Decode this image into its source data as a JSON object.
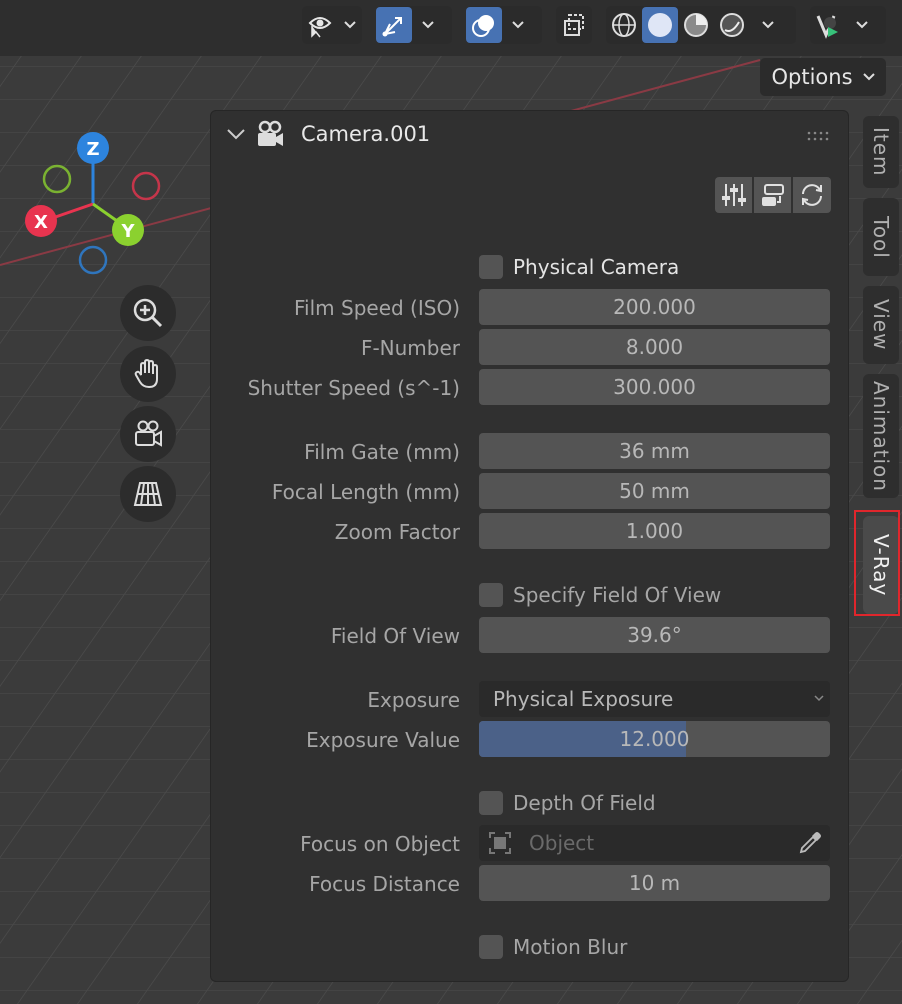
{
  "toolbar": {
    "buttons": [
      {
        "icon": "visibility-selectable-icon",
        "active": false
      },
      {
        "icon": "gizmo-toggle-icon",
        "active": true
      },
      {
        "icon": "overlay-toggle-icon",
        "active": true
      },
      {
        "icon": "xray-toggle-icon",
        "active": false
      },
      {
        "icon": "wireframe-shading-icon",
        "active": false
      },
      {
        "icon": "solid-shading-icon",
        "active": true
      },
      {
        "icon": "material-preview-shading-icon",
        "active": false
      },
      {
        "icon": "rendered-shading-icon",
        "active": false
      },
      {
        "icon": "vray-render-icon",
        "active": false
      }
    ],
    "options_label": "Options"
  },
  "gizmo": {
    "x": "X",
    "y": "Y",
    "z": "Z"
  },
  "nav_icons": [
    "zoom-icon",
    "pan-hand-icon",
    "camera-view-icon",
    "ortho-grid-icon"
  ],
  "panel": {
    "title": "Camera.001",
    "physical_camera": "Physical Camera",
    "film_speed": {
      "label": "Film Speed (ISO)",
      "value": "200.000"
    },
    "f_number": {
      "label": "F-Number",
      "value": "8.000"
    },
    "shutter_speed": {
      "label": "Shutter Speed (s^-1)",
      "value": "300.000"
    },
    "film_gate": {
      "label": "Film Gate (mm)",
      "value": "36 mm"
    },
    "focal_length": {
      "label": "Focal Length (mm)",
      "value": "50 mm"
    },
    "zoom_factor": {
      "label": "Zoom Factor",
      "value": "1.000"
    },
    "specify_fov": "Specify Field Of View",
    "fov": {
      "label": "Field Of View",
      "value": "39.6°"
    },
    "exposure": {
      "label": "Exposure",
      "value": "Physical Exposure"
    },
    "exposure_value": {
      "label": "Exposure Value",
      "value": "12.000",
      "fill_fraction": 0.59
    },
    "depth_of_field": "Depth Of Field",
    "focus_object": {
      "label": "Focus on Object",
      "placeholder": "Object"
    },
    "focus_distance": {
      "label": "Focus Distance",
      "value": "10 m"
    },
    "motion_blur": "Motion Blur"
  },
  "tabs": [
    "Item",
    "Tool",
    "View",
    "Animation",
    "V-Ray"
  ],
  "active_tab": "V-Ray",
  "colors": {
    "accent": "#4772b3",
    "highlight_box": "#e0262c",
    "x_axis": "#e8344f",
    "y_axis": "#8bd12f",
    "z_axis": "#2d84de"
  }
}
